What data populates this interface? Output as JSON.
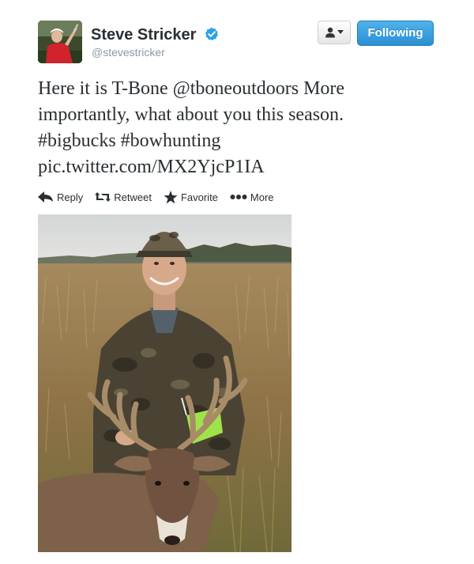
{
  "user": {
    "display_name": "Steve Stricker",
    "screen_name": "@stevestricker",
    "verified": true,
    "avatar_icon": "golfer-avatar"
  },
  "header": {
    "user_menu_icon": "person-dropdown-icon",
    "follow_button_label": "Following"
  },
  "tweet": {
    "lines": [
      "Here it is T-Bone @tboneoutdoors More",
      "importantly, what about you this season.",
      "#bigbucks #bowhunting",
      "pic.twitter.com/MX2YjcP1IA"
    ],
    "mention": "@tboneoutdoors",
    "hashtags": [
      "#bigbucks",
      "#bowhunting"
    ],
    "link_color": "#292f33"
  },
  "actions": {
    "reply": "Reply",
    "retweet": "Retweet",
    "favorite": "Favorite",
    "more": "More"
  },
  "colors": {
    "follow_button": "#2b8ed3",
    "verified_badge": "#2ea0e6",
    "screen_name": "#8899a6"
  },
  "media": {
    "description_icon": "hunter-with-buck-photo"
  }
}
